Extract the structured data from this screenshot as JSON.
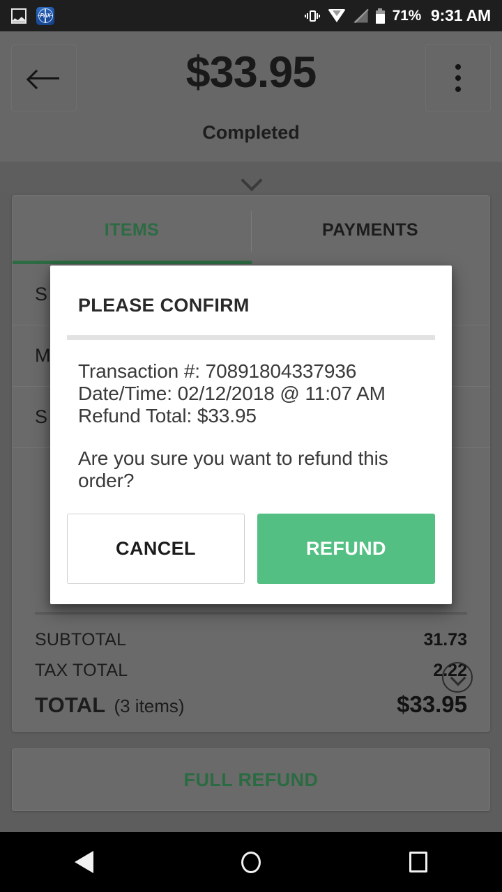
{
  "status_bar": {
    "left_icons": [
      "photo-icon",
      "pax-app-icon"
    ],
    "pax_label": "PAX",
    "right_icons": [
      "vibrate-icon",
      "wifi-icon",
      "no-cell-signal-icon",
      "battery-icon"
    ],
    "battery_percent": "71%",
    "clock": "9:31 AM"
  },
  "header": {
    "back_icon": "arrow-left-icon",
    "amount": "$33.95",
    "status": "Completed",
    "menu_icon": "dots-vertical-icon",
    "expand_icon": "chevron-down-icon"
  },
  "tabs": [
    {
      "label": "ITEMS",
      "active": true
    },
    {
      "label": "PAYMENTS",
      "active": false
    }
  ],
  "items": [
    {
      "label": "S"
    },
    {
      "label": "M"
    },
    {
      "label": "S"
    }
  ],
  "totals": {
    "subtotal_label": "SUBTOTAL",
    "subtotal_value": "31.73",
    "tax_label": "TAX TOTAL",
    "tax_value": "2.22",
    "tax_expand_icon": "chevron-down-circle-icon",
    "total_label": "TOTAL",
    "total_items": "(3 items)",
    "total_value": "$33.95"
  },
  "full_refund_button": "FULL REFUND",
  "dialog": {
    "title": "PLEASE CONFIRM",
    "transaction_line": "Transaction #: 70891804337936",
    "datetime_line": "Date/Time: 02/12/2018 @ 11:07 AM",
    "refund_total_line": "Refund Total: $33.95",
    "question": "Are you sure you want to refund this order?",
    "cancel_label": "CANCEL",
    "refund_label": "REFUND"
  },
  "nav_bar": {
    "back_icon": "nav-back-icon",
    "home_icon": "nav-home-icon",
    "recents_icon": "nav-recents-icon"
  },
  "colors": {
    "accent_green": "#53bf82",
    "tab_green": "#2c6b43",
    "scrim": "#5d5d5d",
    "card": "#6a6a6a",
    "status_bar": "#1e1e1e"
  }
}
